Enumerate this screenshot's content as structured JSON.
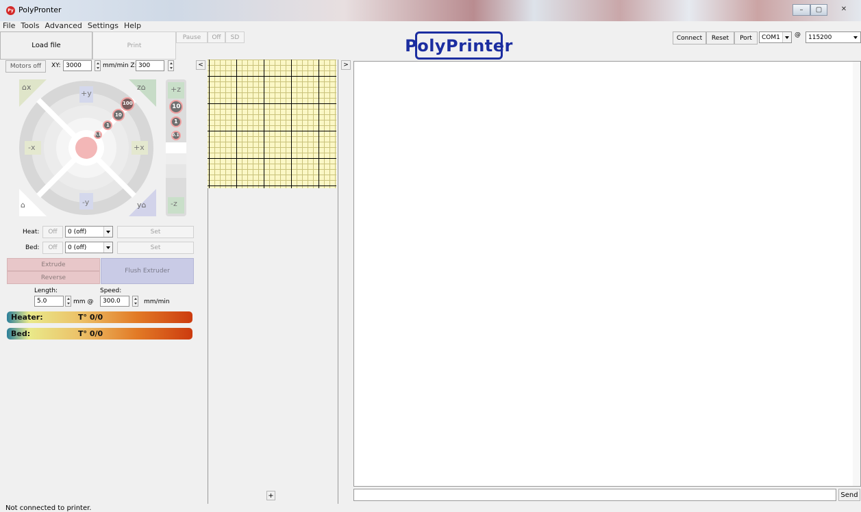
{
  "window": {
    "title": "PolyPronter",
    "app_icon": "Py",
    "minimize": "–",
    "maximize": "▢",
    "close": "✕"
  },
  "menu": [
    "File",
    "Tools",
    "Advanced",
    "Settings",
    "Help"
  ],
  "toolbar": {
    "load_file": "Load file",
    "print": "Print",
    "pause": "Pause",
    "off": "Off",
    "sd": "SD",
    "connect": "Connect",
    "reset": "Reset",
    "port": "Port",
    "port_value": "COM1",
    "at": "@",
    "baud_value": "115200"
  },
  "logo_text": "PolyPrinter",
  "motion": {
    "motors_off": "Motors off",
    "xy_label": "XY:",
    "xy_value": "3000",
    "mm_min_z": "mm/min Z:",
    "z_value": "300",
    "collapse_left": "<",
    "expand_right": ">"
  },
  "jog": {
    "home_x": "⌂x",
    "home_z": "z⌂",
    "home_all": "⌂",
    "home_y": "y⌂",
    "plus_y": "+y",
    "minus_y": "-y",
    "minus_x": "-x",
    "plus_x": "+x",
    "step_100": "100",
    "step_10": "10",
    "step_1": "1",
    "step_01": "0.1",
    "plus_z": "+z",
    "minus_z": "-z",
    "z_step_10": "10",
    "z_step_1": "1",
    "z_step_01": "0.1"
  },
  "temps": {
    "heat_label": "Heat:",
    "heat_off": "Off",
    "heat_value": "0 (off)",
    "heat_set": "Set",
    "bed_label": "Bed:",
    "bed_off": "Off",
    "bed_value": "0 (off)",
    "bed_set": "Set"
  },
  "extruder": {
    "extrude": "Extrude",
    "reverse": "Reverse",
    "flush": "Flush Extruder",
    "length_label": "Length:",
    "length_value": "5.0",
    "mm_at": "mm @",
    "speed_label": "Speed:",
    "speed_value": "300.0",
    "mm_min": "mm/min"
  },
  "gauges": {
    "heater_label": "Heater:",
    "heater_value": "T° 0/0",
    "bed_label": "Bed:",
    "bed_value": "T° 0/0"
  },
  "console": {
    "send": "Send",
    "add_button": "+"
  },
  "status": "Not connected to printer.",
  "colors": {
    "logo": "#1b2da0",
    "extrude_bg": "#e8c7c9",
    "flush_bg": "#c9cbe6"
  }
}
